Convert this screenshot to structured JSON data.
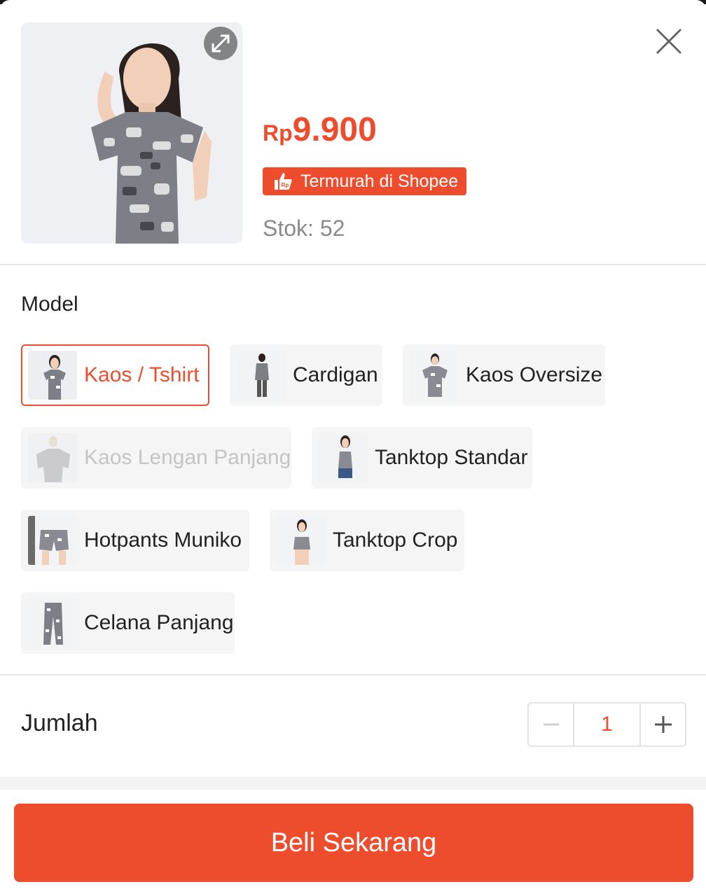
{
  "product": {
    "price_currency": "Rp",
    "price_amount": "9.900",
    "badge_label": "Termurah di Shopee",
    "badge_icon": "thumbs-up-rp-icon",
    "stock_text": "Stok: 52",
    "image_icon": "product-photo",
    "expand_icon": "expand-icon",
    "close_icon": "close-icon"
  },
  "model_section": {
    "label": "Model",
    "selected": "Kaos / Tshirt",
    "options": [
      {
        "label": "Kaos / Tshirt",
        "state": "selected"
      },
      {
        "label": "Cardigan",
        "state": "available"
      },
      {
        "label": "Kaos Oversize",
        "state": "available"
      },
      {
        "label": "Kaos Lengan Panjang",
        "state": "disabled"
      },
      {
        "label": "Tanktop Standar",
        "state": "available"
      },
      {
        "label": "Hotpants Muniko",
        "state": "available"
      },
      {
        "label": "Tanktop Crop",
        "state": "available"
      },
      {
        "label": "Celana Panjang",
        "state": "available"
      }
    ]
  },
  "quantity": {
    "label": "Jumlah",
    "value": "1",
    "minus_icon": "minus-icon",
    "plus_icon": "plus-icon"
  },
  "footer": {
    "buy_label": "Beli Sekarang"
  },
  "colors": {
    "accent": "#ee4d2d",
    "muted_text": "#8a8a8a",
    "chip_bg": "#f5f5f5"
  }
}
